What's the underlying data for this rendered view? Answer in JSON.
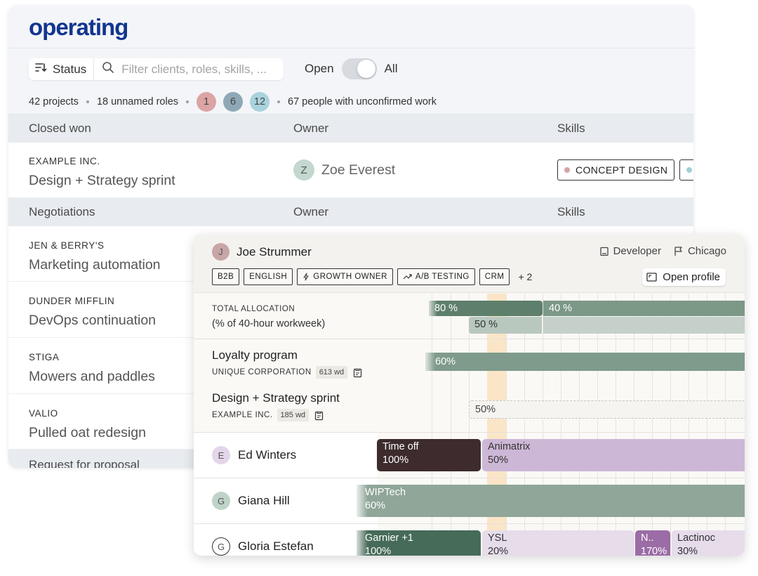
{
  "app": {
    "logo": "operating"
  },
  "toolbar": {
    "status_label": "Status",
    "search_placeholder": "Filter clients, roles, skills, ...",
    "toggle_left": "Open",
    "toggle_right": "All"
  },
  "summary": {
    "projects": "42 projects",
    "unnamed_roles": "18 unnamed roles",
    "badges": [
      {
        "value": "1",
        "color": "#dca4a4"
      },
      {
        "value": "6",
        "color": "#8ea8b6"
      },
      {
        "value": "12",
        "color": "#a9d3dd"
      }
    ],
    "unconfirmed": "67 people with unconfirmed work"
  },
  "sections": [
    {
      "title": "Closed won",
      "owner_header": "Owner",
      "skills_header": "Skills",
      "rows": [
        {
          "client": "EXAMPLE INC.",
          "name": "Design + Strategy sprint",
          "owner_initial": "Z",
          "owner_name": "Zoe Everest",
          "skills": [
            {
              "label": "CONCEPT DESIGN",
              "dot": "#d7a3a3"
            },
            {
              "label": "",
              "dot": "#9fd0d8"
            }
          ]
        }
      ]
    },
    {
      "title": "Negotiations",
      "owner_header": "Owner",
      "skills_header": "Skills",
      "rows": [
        {
          "client": "JEN & BERRY'S",
          "name": "Marketing automation"
        },
        {
          "client": "DUNDER MIFFLIN",
          "name": "DevOps continuation"
        },
        {
          "client": "STIGA",
          "name": "Mowers and paddles"
        },
        {
          "client": "VALIO",
          "name": "Pulled oat redesign"
        }
      ]
    },
    {
      "title": "Request for proposal"
    }
  ],
  "person": {
    "initial": "J",
    "name": "Joe Strummer",
    "role": "Developer",
    "location": "Chicago",
    "tags": [
      "B2B",
      "ENGLISH",
      "GROWTH OWNER",
      "A/B TESTING",
      "CRM"
    ],
    "more": "+ 2",
    "open_profile": "Open profile"
  },
  "allocation": {
    "label_top": "TOTAL ALLOCATION",
    "label_bottom": "(% of 40-hour workweek)",
    "bars": [
      "80 %",
      "40 %",
      "50 %"
    ]
  },
  "assignments": [
    {
      "name": "Loyalty program",
      "client": "UNIQUE CORPORATION",
      "wd": "613 wd",
      "bar": "60%"
    },
    {
      "name": "Design + Strategy sprint",
      "client": "EXAMPLE INC.",
      "wd": "185 wd",
      "bar": "50%"
    }
  ],
  "people": [
    {
      "initial": "E",
      "name": "Ed Winters",
      "bars": [
        {
          "title": "Time off",
          "pct": "100%"
        },
        {
          "title": "Animatrix",
          "pct": "50%"
        }
      ]
    },
    {
      "initial": "G",
      "name": "Giana Hill",
      "bars": [
        {
          "title": "WIPTech",
          "pct": "60%"
        }
      ]
    },
    {
      "initial": "G",
      "name": "Gloria Estefan",
      "bars": [
        {
          "title": "Garnier +1",
          "pct": "100%"
        },
        {
          "title": "YSL",
          "pct": "20%"
        },
        {
          "title": "N..",
          "pct": "170%"
        },
        {
          "title": "Lactinoc",
          "pct": "30%"
        }
      ]
    }
  ],
  "colors": {
    "brand": "#12358f",
    "green_dark": "#5e7f6c",
    "green_mid": "#7f9b8b",
    "lavender": "#cdb7d6",
    "lavender_light": "#e6dcea",
    "purple": "#9b6ca6",
    "maroon": "#3d2b2d",
    "highlight": "#fcd6a1"
  }
}
